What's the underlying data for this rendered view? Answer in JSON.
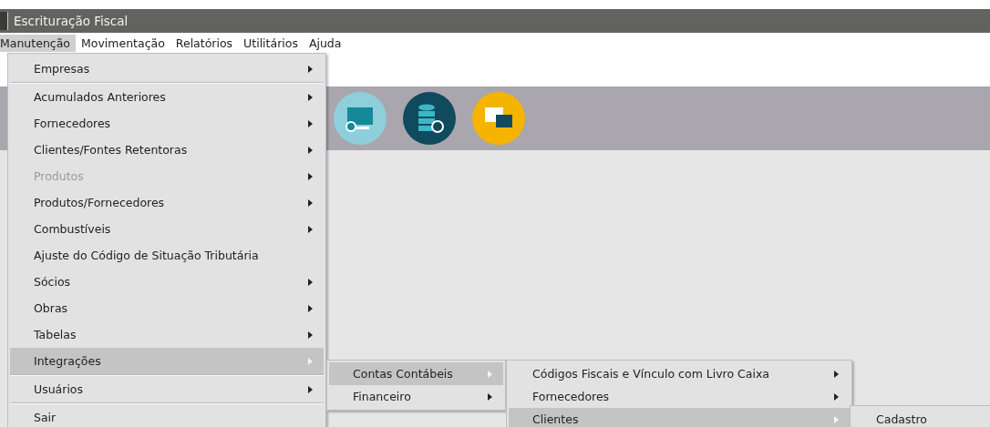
{
  "window": {
    "title": "Escrituração Fiscal"
  },
  "menubar": [
    {
      "label": "Manutenção",
      "selected": true
    },
    {
      "label": "Movimentação",
      "selected": false
    },
    {
      "label": "Relatórios",
      "selected": false
    },
    {
      "label": "Utilitários",
      "selected": false
    },
    {
      "label": "Ajuda",
      "selected": false
    }
  ],
  "menus": [
    {
      "items": [
        {
          "label": "Empresas",
          "submenu": true,
          "disabled": false,
          "selected": false,
          "separator_after": true
        },
        {
          "label": "Acumulados Anteriores",
          "submenu": true,
          "disabled": false,
          "selected": false,
          "separator_after": false
        },
        {
          "label": "Fornecedores",
          "submenu": true,
          "disabled": false,
          "selected": false,
          "separator_after": false
        },
        {
          "label": "Clientes/Fontes Retentoras",
          "submenu": true,
          "disabled": false,
          "selected": false,
          "separator_after": false
        },
        {
          "label": "Produtos",
          "submenu": true,
          "disabled": true,
          "selected": false,
          "separator_after": false
        },
        {
          "label": "Produtos/Fornecedores",
          "submenu": true,
          "disabled": false,
          "selected": false,
          "separator_after": false
        },
        {
          "label": "Combustíveis",
          "submenu": true,
          "disabled": false,
          "selected": false,
          "separator_after": false
        },
        {
          "label": "Ajuste do Código de Situação Tributária",
          "submenu": false,
          "disabled": false,
          "selected": false,
          "separator_after": false
        },
        {
          "label": "Sócios",
          "submenu": true,
          "disabled": false,
          "selected": false,
          "separator_after": false
        },
        {
          "label": "Obras",
          "submenu": true,
          "disabled": false,
          "selected": false,
          "separator_after": false
        },
        {
          "label": "Tabelas",
          "submenu": true,
          "disabled": false,
          "selected": false,
          "separator_after": false
        },
        {
          "label": "Integrações",
          "submenu": true,
          "disabled": false,
          "selected": true,
          "separator_after": true
        },
        {
          "label": "Usuários",
          "submenu": true,
          "disabled": false,
          "selected": false,
          "separator_after": true
        },
        {
          "label": "Sair",
          "submenu": false,
          "disabled": false,
          "selected": false,
          "separator_after": false
        }
      ]
    },
    {
      "items": [
        {
          "label": "Contas Contábeis",
          "submenu": true,
          "disabled": false,
          "selected": true
        },
        {
          "label": "Financeiro",
          "submenu": true,
          "disabled": false,
          "selected": false
        }
      ]
    },
    {
      "items": [
        {
          "label": "Códigos Fiscais e Vínculo com Livro Caixa",
          "submenu": true,
          "disabled": false,
          "selected": false
        },
        {
          "label": "Fornecedores",
          "submenu": true,
          "disabled": false,
          "selected": false
        },
        {
          "label": "Clientes",
          "submenu": true,
          "disabled": false,
          "selected": true
        }
      ]
    },
    {
      "items": [
        {
          "label": "Cadastro",
          "submenu": false,
          "disabled": false,
          "selected": false
        }
      ]
    }
  ]
}
